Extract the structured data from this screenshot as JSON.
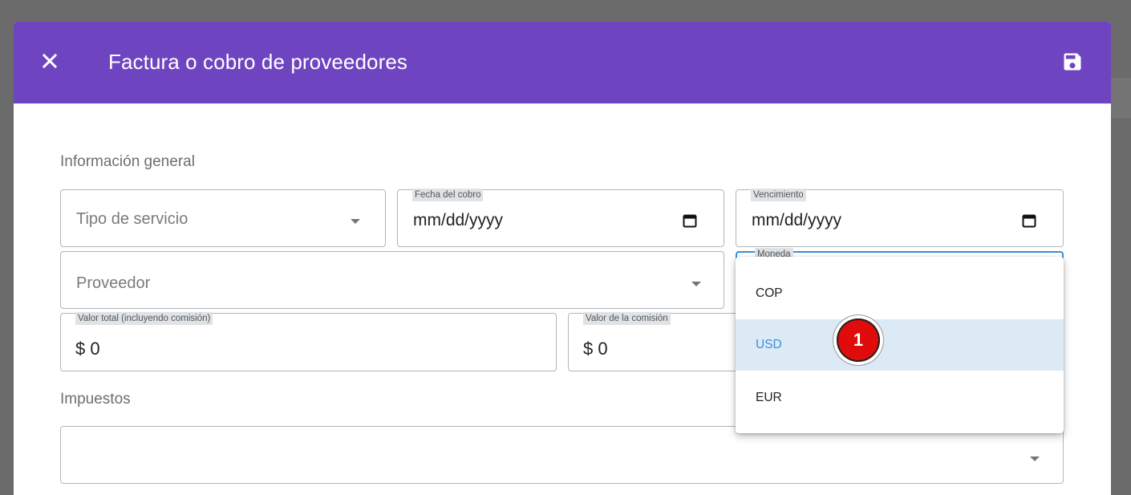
{
  "dialog": {
    "title": "Factura o cobro de proveedores",
    "close_icon": "close-icon",
    "save_icon": "save-floppy-icon"
  },
  "sections": {
    "general": "Información general",
    "taxes": "Impuestos"
  },
  "fields": {
    "service_type": {
      "placeholder": "Tipo de servicio"
    },
    "charge_date": {
      "label": "Fecha del cobro",
      "value": "mm/dd/yyyy"
    },
    "due_date": {
      "label": "Vencimiento",
      "value": "mm/dd/yyyy"
    },
    "provider": {
      "placeholder": "Proveedor"
    },
    "currency": {
      "label": "Moneda"
    },
    "total_value": {
      "label": "Valor total (incluyendo comisión)",
      "value": "$ 0"
    },
    "commission_value": {
      "label": "Valor de la comisión",
      "value": "$ 0"
    },
    "taxes": {
      "value": ""
    }
  },
  "currency_menu": {
    "options": [
      "COP",
      "USD",
      "EUR"
    ],
    "selected": "USD"
  },
  "annotation": {
    "label": "1"
  },
  "colors": {
    "header": "#6f44c1",
    "selected_bg": "#dceaf6",
    "selected_text": "#3b8fd6",
    "badge": "#e00b0b"
  }
}
